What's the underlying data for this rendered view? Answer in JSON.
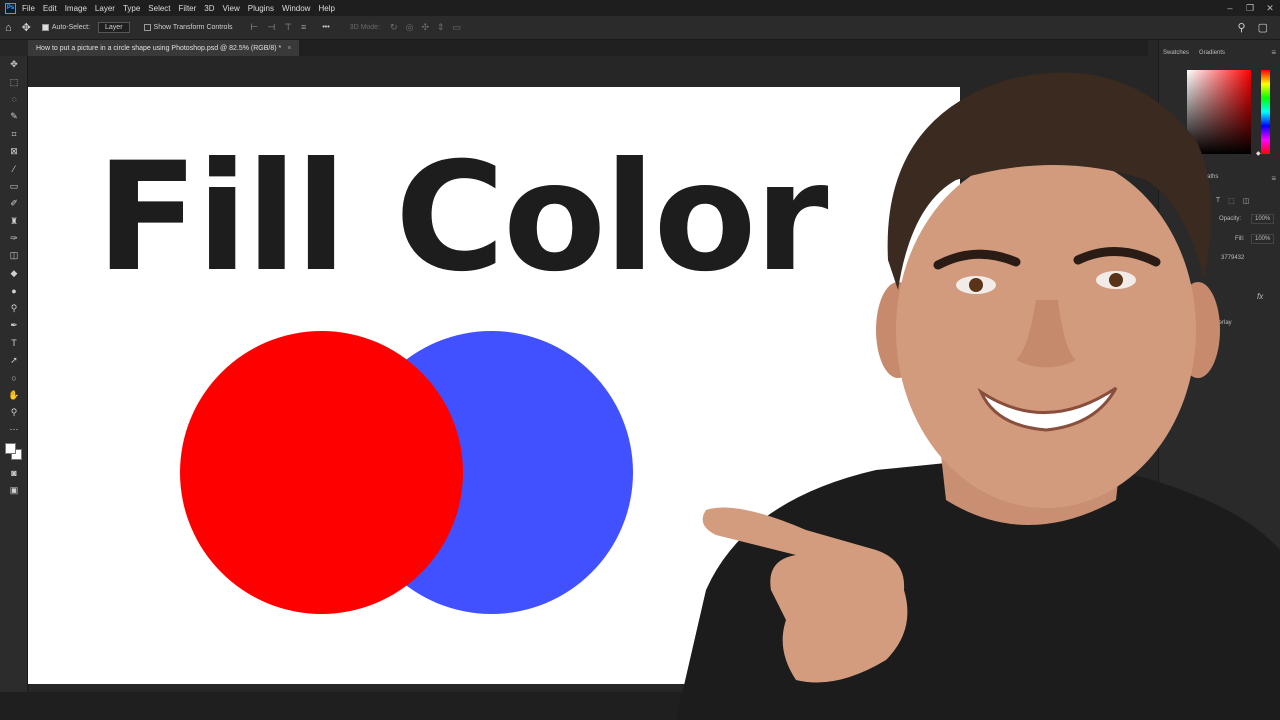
{
  "app": {
    "logo": "Ps"
  },
  "menu": [
    "File",
    "Edit",
    "Image",
    "Layer",
    "Type",
    "Select",
    "Filter",
    "3D",
    "View",
    "Plugins",
    "Window",
    "Help"
  ],
  "window_controls": [
    "–",
    "❐",
    "✕"
  ],
  "options_bar": {
    "auto_select_label": "Auto-Select:",
    "auto_select_target": "Layer",
    "transform_controls_label": "Show Transform Controls",
    "more_label": "•••",
    "mode_3d_label": "3D Mode:"
  },
  "document_tab": {
    "title": "How to put a picture in a circle shape using Photoshop.psd @ 82.5% (RGB/8) *",
    "close": "×"
  },
  "canvas": {
    "title_text": "Fill Color",
    "shapes": [
      {
        "name": "blue-circle",
        "color": "#4251ff"
      },
      {
        "name": "red-circle",
        "color": "#ff0000"
      }
    ]
  },
  "right_panel": {
    "tabs": [
      "Swatches",
      "Gradients"
    ],
    "paths_tab": "Paths",
    "opacity_label": "Opacity:",
    "opacity_value": "100%",
    "fill_label": "Fill:",
    "fill_value": "100%",
    "layer_name": "3779432",
    "fx_label": "fx",
    "overlay_label": "Overlay"
  },
  "colors": {
    "menubar_bg": "#1e1e1e",
    "panel_bg": "#2a2a2a",
    "canvas_bg": "#ffffff",
    "ps_blue": "#31a8ff"
  }
}
